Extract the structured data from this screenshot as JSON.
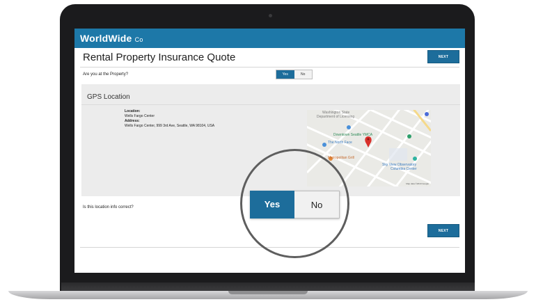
{
  "app": {
    "logo_main": "WorldWide",
    "logo_suffix": "Co",
    "page_title": "Rental Property Insurance Quote",
    "next_label": "NEXT"
  },
  "at_property": {
    "question": "Are you at the Property?",
    "yes_label": "Yes",
    "no_label": "No",
    "selected": "Yes"
  },
  "gps": {
    "title": "GPS Location",
    "location_label": "Location:",
    "location_value": "Wells Fargo Center",
    "address_label": "Address:",
    "address_value": "Wells Fargo Center, 999 3rd Ave, Seattle, WA 98104, USA"
  },
  "map": {
    "labels": {
      "wa_state_1": "Washington State",
      "wa_state_2": "Department of Licensing",
      "downtown": "Downtown Seattle YMCA",
      "north_face": "The North Face",
      "metropolitan": "Metropolitan Grill",
      "sky_view_1": "Sky View Observatory",
      "sky_view_2": "Columbia Center",
      "attribution": "Map data ©2019 Google"
    },
    "colors": {
      "pin": "#d9302b",
      "road": "#ffffff",
      "land": "#eaeae6"
    }
  },
  "confirm": {
    "question": "Is this location info correct?",
    "yes_label": "Yes",
    "no_label": "No",
    "selected": "Yes"
  },
  "colors": {
    "brand": "#1d78a8",
    "button": "#1d6d9b"
  }
}
